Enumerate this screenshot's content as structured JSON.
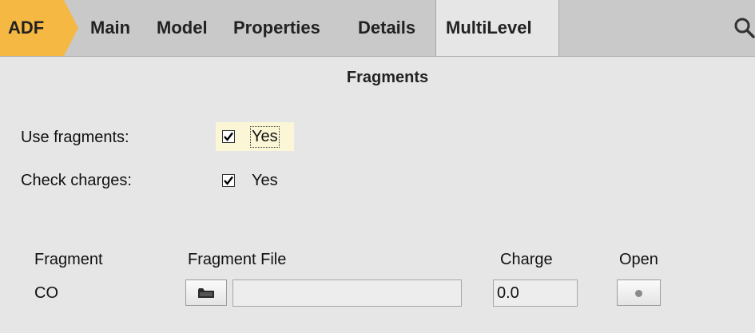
{
  "tabs": {
    "adf": "ADF",
    "main": "Main",
    "model": "Model",
    "properties": "Properties",
    "details": "Details",
    "multilevel": "MultiLevel"
  },
  "colors": {
    "adf_tab": "#f5b843",
    "tabbar": "#c9c9c9",
    "panel": "#e6e6e6"
  },
  "search_icon": "search-icon",
  "section_title": "Fragments",
  "options": {
    "use_fragments": {
      "label": "Use fragments:",
      "checked": true,
      "text": "Yes"
    },
    "check_charges": {
      "label": "Check charges:",
      "checked": true,
      "text": "Yes"
    }
  },
  "table": {
    "headers": {
      "fragment": "Fragment",
      "file": "Fragment File",
      "charge": "Charge",
      "open": "Open"
    },
    "rows": [
      {
        "fragment": "CO",
        "file": "",
        "charge": "0.0"
      }
    ]
  }
}
